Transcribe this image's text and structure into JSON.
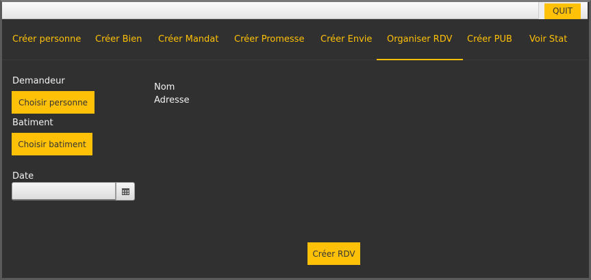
{
  "topbar": {
    "quit_label": "QUIT"
  },
  "tabs": [
    {
      "label": "Créer personne",
      "active": false
    },
    {
      "label": "Créer Bien",
      "active": false
    },
    {
      "label": "Créer Mandat",
      "active": false
    },
    {
      "label": "Créer Promesse",
      "active": false
    },
    {
      "label": "Créer Envie",
      "active": false
    },
    {
      "label": "Organiser RDV",
      "active": true
    },
    {
      "label": "Créer PUB",
      "active": false
    },
    {
      "label": "Voir Stat",
      "active": false
    }
  ],
  "form": {
    "demandeur_label": "Demandeur",
    "choose_person_label": "Choisir personne",
    "batiment_label": "Batiment",
    "choose_building_label": "Choisir batiment",
    "date_label": "Date",
    "date_value": "",
    "calendar_icon": "calendar-icon"
  },
  "details": {
    "nom_label": "Nom",
    "adresse_label": "Adresse"
  },
  "actions": {
    "create_rdv_label": "Créer RDV"
  },
  "colors": {
    "accent": "#ffc107",
    "background": "#303030",
    "text": "#f2f2f2"
  }
}
